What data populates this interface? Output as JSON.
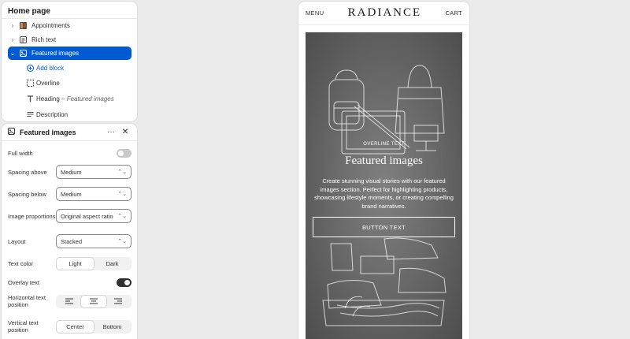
{
  "tree": {
    "title": "Home page",
    "sections": [
      {
        "label": "Appointments",
        "icon": "image-thumbnail-icon",
        "expanded": false
      },
      {
        "label": "Rich text",
        "icon": "text-block-icon",
        "expanded": false
      },
      {
        "label": "Featured images",
        "icon": "image-section-icon",
        "expanded": true,
        "selected": true
      }
    ],
    "blocks": [
      {
        "label": "Add block",
        "icon": "plus-circle-icon"
      },
      {
        "label": "Overline",
        "icon": "dashed-square-icon"
      },
      {
        "label": "Heading",
        "suffix": "Featured images",
        "icon": "text-t-icon"
      },
      {
        "label": "Description",
        "icon": "paragraph-icon"
      }
    ]
  },
  "settings": {
    "title": "Featured images",
    "more_glyph": "···",
    "close_glyph": "✕",
    "full_width": {
      "label": "Full width",
      "on": false
    },
    "spacing_above": {
      "label": "Spacing above",
      "value": "Medium"
    },
    "spacing_below": {
      "label": "Spacing below",
      "value": "Medium"
    },
    "image_proportions": {
      "label": "Image proportions",
      "value": "Original aspect ratio"
    },
    "layout": {
      "label": "Layout",
      "value": "Stacked"
    },
    "text_color": {
      "label": "Text color",
      "options": [
        "Light",
        "Dark"
      ],
      "selected": "Light"
    },
    "overlay_text": {
      "label": "Overlay text",
      "on": true
    },
    "horizontal_position": {
      "label": "Horizontal text position",
      "selected": "center"
    },
    "vertical_position": {
      "label": "Vertical text position",
      "options": [
        "Center",
        "Bottom"
      ],
      "selected": "Center"
    }
  },
  "preview": {
    "menu": "MENU",
    "brand": "RADIANCE",
    "cart": "CART",
    "overline": "OVERLINE TEXT",
    "heading": "Featured images",
    "description": "Create stunning visual stories with our featured images section. Perfect for highlighting products, showcasing lifestyle moments, or creating compelling brand narratives.",
    "button": "BUTTON TEXT"
  },
  "colors": {
    "accent": "#005bd3",
    "toggle_on": "#303030",
    "toggle_off": "#c9c9c9",
    "panel_bg": "#ffffff",
    "canvas_bg": "#ebebeb"
  }
}
